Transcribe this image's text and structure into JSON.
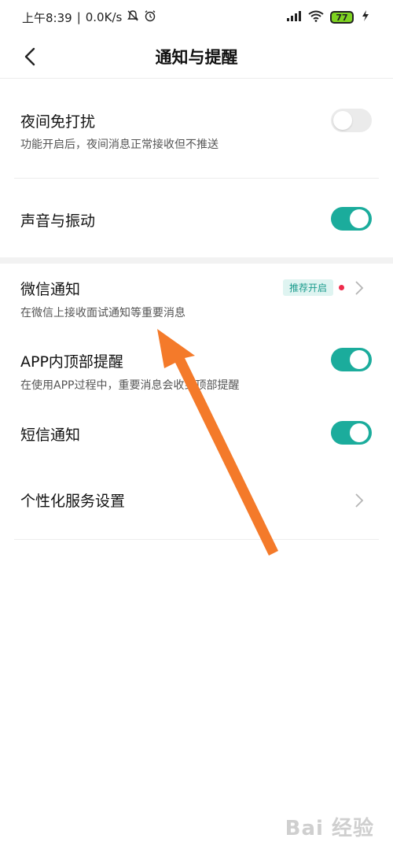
{
  "status_bar": {
    "time": "上午8:39",
    "separator": "|",
    "speed": "0.0K/s",
    "battery": "77",
    "icons": [
      "mute-icon",
      "alarm-icon",
      "signal-icon",
      "wifi-icon",
      "battery-icon",
      "charging-icon"
    ]
  },
  "header": {
    "title": "通知与提醒",
    "back_icon": "back-arrow-icon"
  },
  "rows": {
    "night_dnd": {
      "title": "夜间免打扰",
      "subtitle": "功能开启后，夜间消息正常接收但不推送",
      "toggle_on": false
    },
    "sound_vibrate": {
      "title": "声音与振动",
      "toggle_on": true
    },
    "wechat_notify": {
      "title": "微信通知",
      "subtitle": "在微信上接收面试通知等重要消息",
      "badge": "推荐开启"
    },
    "in_app_banner": {
      "title": "APP内顶部提醒",
      "subtitle": "在使用APP过程中，重要消息会收到顶部提醒",
      "toggle_on": true
    },
    "sms_notify": {
      "title": "短信通知",
      "toggle_on": true
    },
    "personalized": {
      "title": "个性化服务设置"
    }
  },
  "colors": {
    "accent": "#1bac9c",
    "badge_bg": "#dff4f1",
    "badge_text": "#1a9b8d",
    "red_dot": "#ee2b4b",
    "annotation_arrow": "#f47a2a"
  },
  "watermark": "Bai 经验"
}
